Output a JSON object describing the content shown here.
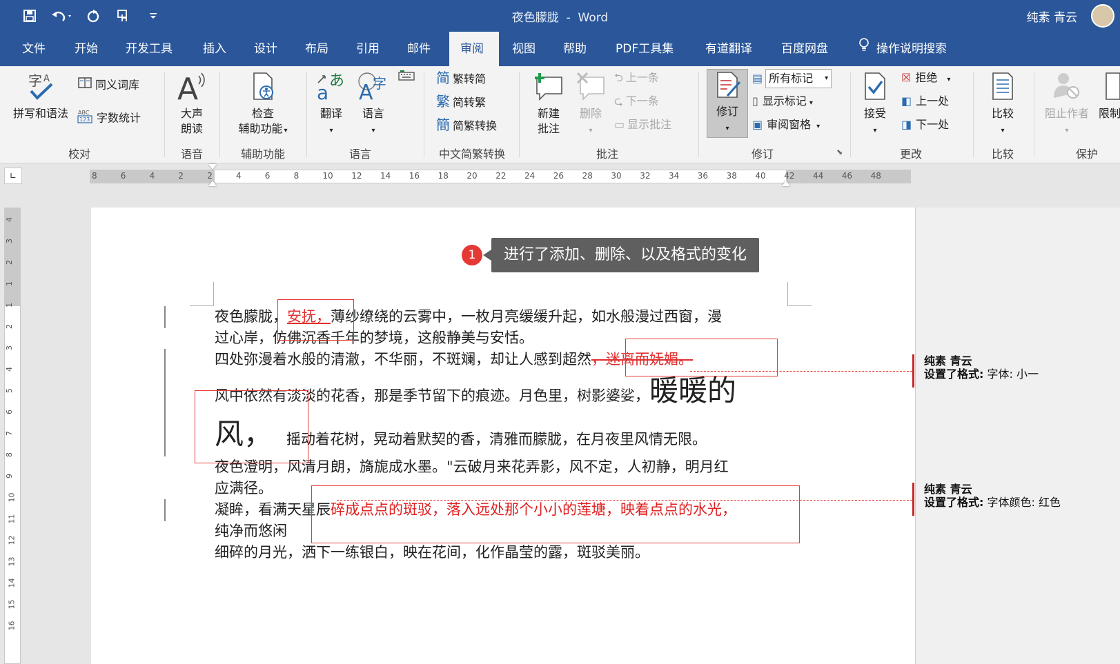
{
  "titlebar": {
    "doc_name": "夜色朦胧",
    "separator": "-",
    "app_name": "Word",
    "user_name": "纯素 青云",
    "quick_access_icons": [
      "save-icon",
      "undo-icon",
      "redo-icon",
      "touch-mode-icon",
      "customize-icon"
    ]
  },
  "tabs": [
    "文件",
    "开始",
    "开发工具",
    "插入",
    "设计",
    "布局",
    "引用",
    "邮件",
    "审阅",
    "视图",
    "帮助",
    "PDF工具集",
    "有道翻译",
    "百度网盘"
  ],
  "active_tab": "审阅",
  "search_label": "操作说明搜索",
  "ribbon": {
    "proofing": {
      "label": "校对",
      "spelling": "拼写和语法",
      "thesaurus": "同义词库",
      "word_count": "字数统计"
    },
    "speech": {
      "label": "语音",
      "read_aloud_1": "大声",
      "read_aloud_2": "朗读"
    },
    "accessibility": {
      "label": "辅助功能",
      "check_1": "检查",
      "check_2": "辅助功能"
    },
    "language": {
      "label": "语言",
      "translate": "翻译",
      "language": "语言"
    },
    "chinese": {
      "label": "中文简繁转换",
      "to_simplified": "繁转简",
      "to_traditional": "简转繁",
      "convert": "简繁转换"
    },
    "comments": {
      "label": "批注",
      "new_1": "新建",
      "new_2": "批注",
      "delete": "删除",
      "prev": "上一条",
      "next": "下一条",
      "show": "显示批注"
    },
    "tracking": {
      "label": "修订",
      "track_changes": "修订",
      "markup_select": "所有标记",
      "show_markup": "显示标记",
      "review_pane": "审阅窗格"
    },
    "changes": {
      "label": "更改",
      "accept": "接受",
      "reject": "拒绝",
      "previous": "上一处",
      "next": "下一处"
    },
    "compare": {
      "label": "比较",
      "compare": "比较"
    },
    "protect": {
      "label": "保护",
      "block_authors": "阻止作者",
      "restrict": "限制"
    }
  },
  "ruler_numbers": [
    "8",
    "6",
    "4",
    "2",
    "2",
    "4",
    "6",
    "8",
    "10",
    "12",
    "14",
    "16",
    "18",
    "20",
    "22",
    "24",
    "26",
    "28",
    "30",
    "32",
    "34",
    "36",
    "38",
    "40",
    "42",
    "44",
    "46",
    "48"
  ],
  "vruler_numbers": [
    "4",
    "3",
    "2",
    "1",
    "1",
    "2",
    "3",
    "4",
    "5",
    "6",
    "7",
    "8",
    "9",
    "10",
    "11",
    "12",
    "13",
    "14",
    "15",
    "16"
  ],
  "callout": {
    "badge": "1",
    "text": "进行了添加、删除、以及格式的变化"
  },
  "document": {
    "p1_a": "夜色朦胧，",
    "p1_ins": "安抚，",
    "p1_b": "薄纱缭绕的云雾中，一枚月亮缓缓升起，如水般漫过西窗，漫",
    "p1_c": "过心岸，仿佛沉香千年的梦境，这般静美与安恬。",
    "p2_a": "四处弥漫着水般的清澈，不华丽，不斑斓，却让人感到超然",
    "p2_del": "，迷离而妩媚。",
    "p3_a": "风中依然有淡淡的花香，那是季节留下的痕迹。月色里，树影婆娑，",
    "p3_big1": "暖暖的",
    "p3_big2": "风，",
    "p3_b": "摇动着花树，晃动着默契的香，清雅而朦胧，在月夜里风情无限。",
    "p4_a": "夜色澄明，风清月朗，旖旎成水墨。\"云破月来花弄影，风不定，人初静，明月红",
    "p4_b": "应满径。",
    "p5_a": "凝眸，看满天星辰",
    "p5_red": "碎成点点的斑驳，落入远处那个小小的莲塘，映着点点的水光，",
    "p5_b": "纯净而悠闲",
    "p6": "细碎的月光，洒下一练银白，映在花间，化作晶莹的露，斑驳美丽。"
  },
  "balloons": [
    {
      "author": "纯素  青云",
      "label": "设置了格式:",
      "detail": "字体: 小一"
    },
    {
      "author": "纯素  青云",
      "label": "设置了格式:",
      "detail": "字体颜色: 红色"
    }
  ],
  "colors": {
    "word_blue": "#2b579a",
    "annotation_red": "#e53935",
    "insert_red": "#e03030"
  }
}
